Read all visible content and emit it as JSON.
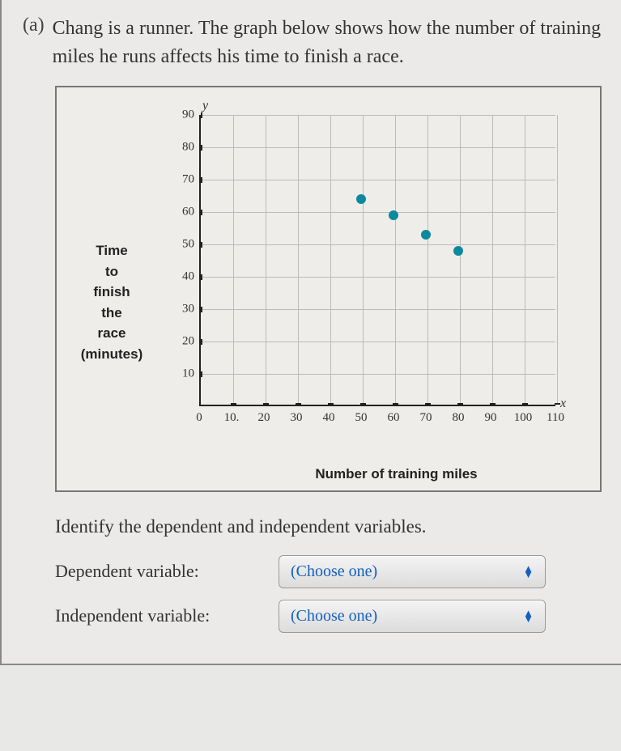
{
  "question": {
    "label": "(a)",
    "text": "Chang is a runner. The graph below shows how the number of training miles he runs affects his time to finish a race."
  },
  "chart_data": {
    "type": "scatter",
    "title": "",
    "xlabel": "Number of training miles",
    "ylabel": "Time\nto\nfinish\nthe\nrace\n(minutes)",
    "y_axis_letter": "y",
    "x_axis_letter": "x",
    "xlim": [
      0,
      110
    ],
    "ylim": [
      0,
      90
    ],
    "xticks": [
      0,
      10,
      20,
      30,
      40,
      50,
      60,
      70,
      80,
      90,
      100,
      110
    ],
    "yticks": [
      10,
      20,
      30,
      40,
      50,
      60,
      70,
      80,
      90
    ],
    "origin_label": "0",
    "points": [
      {
        "x": 50,
        "y": 64
      },
      {
        "x": 60,
        "y": 59
      },
      {
        "x": 70,
        "y": 53
      },
      {
        "x": 80,
        "y": 48
      }
    ]
  },
  "identify_prompt": "Identify the dependent and independent variables.",
  "rows": {
    "dependent": {
      "label": "Dependent variable:",
      "placeholder": "(Choose one)"
    },
    "independent": {
      "label": "Independent variable:",
      "placeholder": "(Choose one)"
    }
  }
}
